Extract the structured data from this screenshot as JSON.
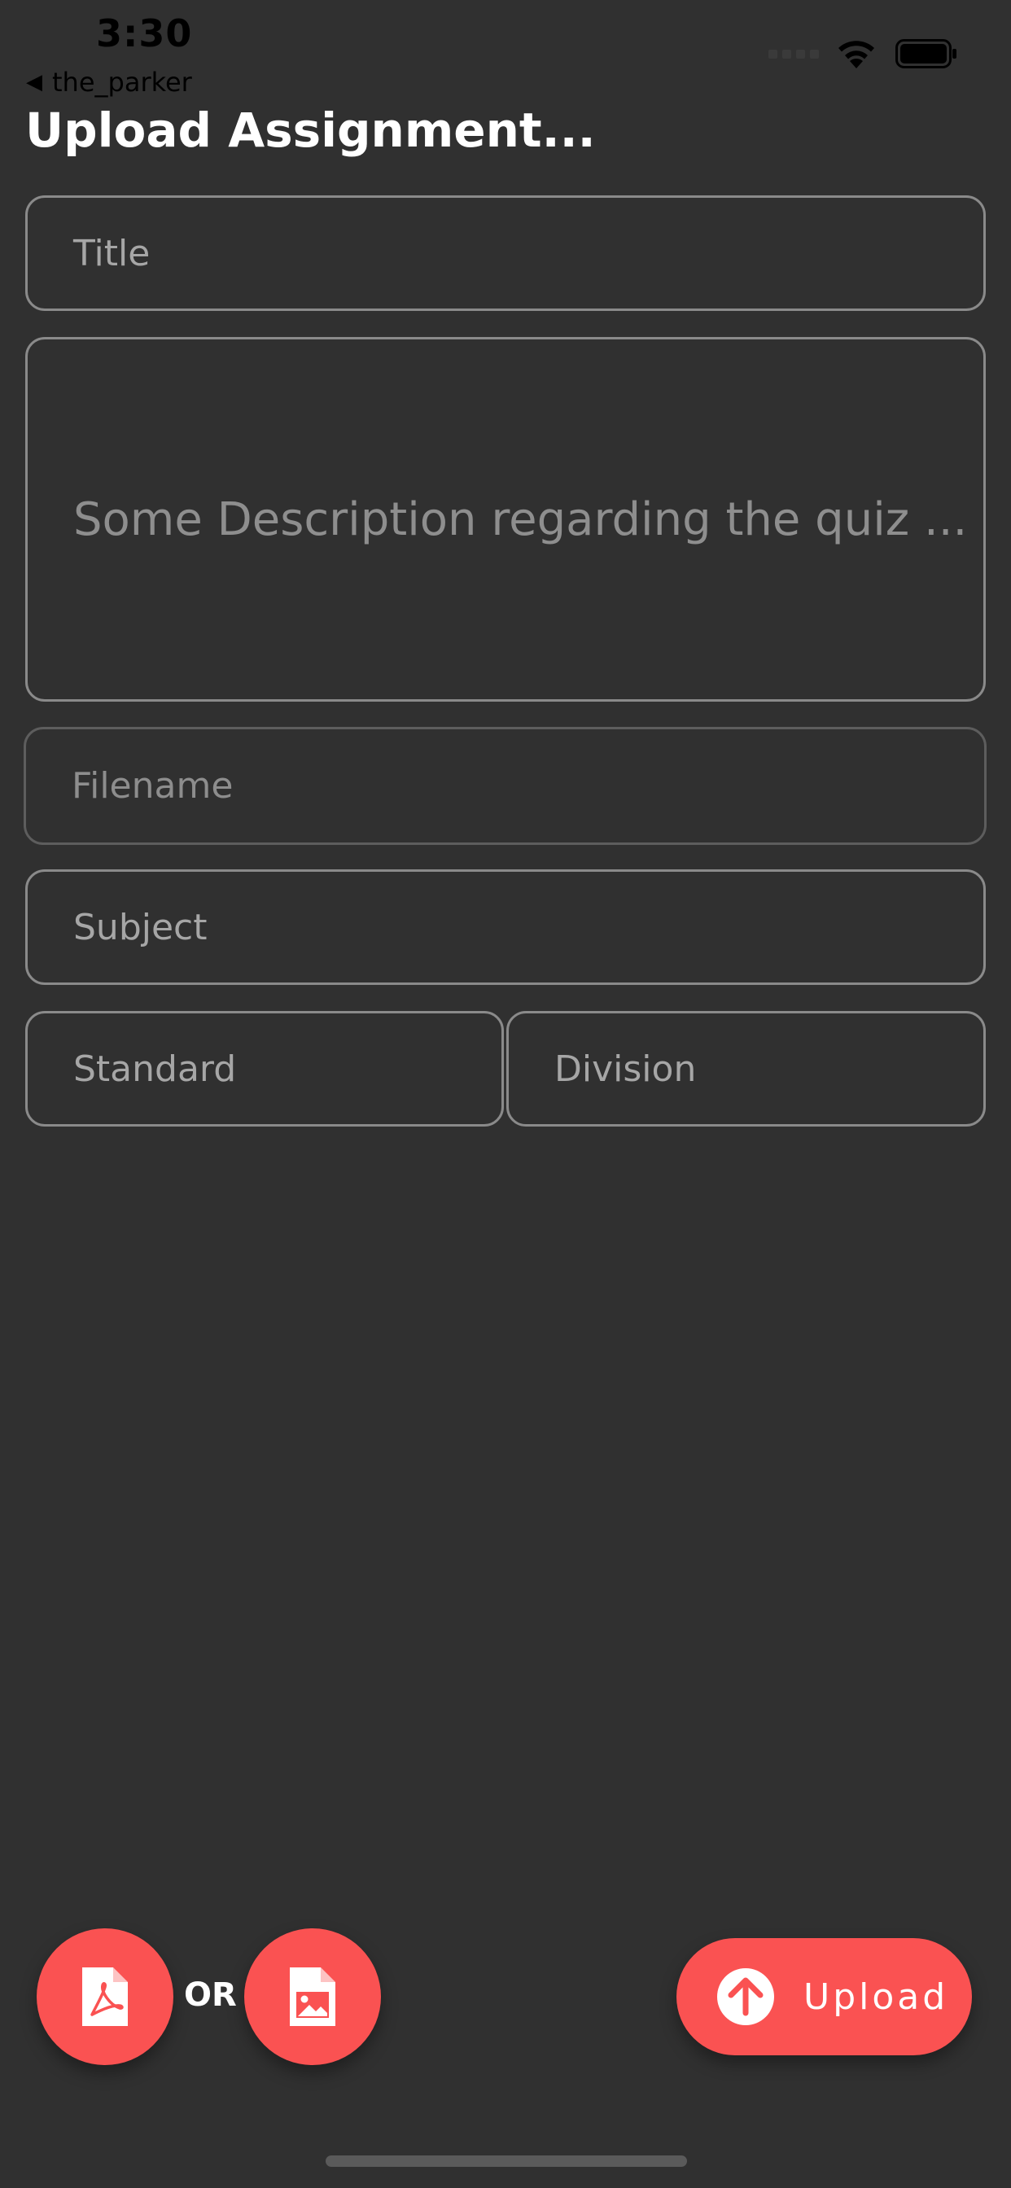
{
  "status_bar": {
    "time": "3:30"
  },
  "nav": {
    "back_label": "the_parker",
    "back_icon": "back-triangle-icon"
  },
  "page": {
    "title": "Upload Assignment..."
  },
  "form": {
    "title_placeholder": "Title",
    "description_placeholder": "Some Description regarding the quiz ...",
    "filename_placeholder": "Filename",
    "subject_placeholder": "Subject",
    "standard_placeholder": "Standard",
    "division_placeholder": "Division"
  },
  "actions": {
    "or_label": "OR",
    "upload_label": "Upload",
    "pdf_icon": "pdf-file-icon",
    "image_icon": "image-file-icon",
    "upload_icon": "arrow-up-circle-icon"
  },
  "colors": {
    "background": "#303030",
    "accent": "#fa5252",
    "field_border": "#8a8a8a",
    "placeholder": "#a6a6a6"
  }
}
